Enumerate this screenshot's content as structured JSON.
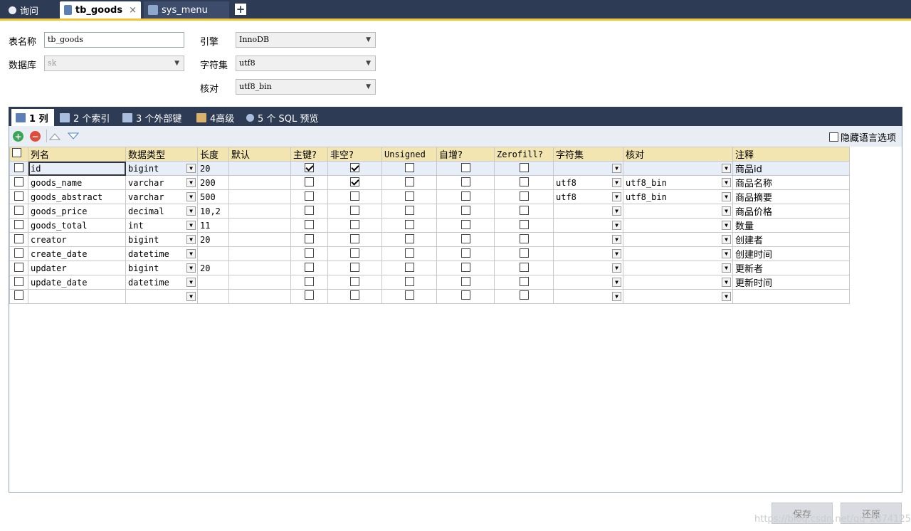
{
  "tabs": [
    {
      "label": "询问",
      "active": false
    },
    {
      "label": "tb_goods",
      "active": true,
      "close": "×"
    },
    {
      "label": "sys_menu",
      "active": false
    }
  ],
  "new_tab": "+",
  "form": {
    "table_name_label": "表名称",
    "table_name_value": "tb_goods",
    "database_label": "数据库",
    "database_value": "sk",
    "engine_label": "引擎",
    "engine_value": "InnoDB",
    "charset_label": "字符集",
    "charset_value": "utf8",
    "collation_label": "核对",
    "collation_value": "utf8_bin"
  },
  "subtabs": [
    {
      "label": "1 列",
      "active": true
    },
    {
      "label": "2 个索引",
      "active": false
    },
    {
      "label": "3 个外部键",
      "active": false
    },
    {
      "label": "4高级",
      "active": false
    },
    {
      "label": "5 个 SQL 预览",
      "active": false
    }
  ],
  "toolbar": {
    "hide_lang_label": "隐藏语言选项"
  },
  "columns": [
    "列名",
    "数据类型",
    "长度",
    "默认",
    "主键?",
    "非空?",
    "Unsigned",
    "自增?",
    "Zerofill?",
    "字符集",
    "核对",
    "注释"
  ],
  "rows": [
    {
      "name": "id",
      "type": "bigint",
      "length": "20",
      "default": "",
      "pk": true,
      "notnull": true,
      "unsigned": false,
      "autoinc": false,
      "zerofill": false,
      "charset": "",
      "collation": "",
      "comment": "商品id"
    },
    {
      "name": "goods_name",
      "type": "varchar",
      "length": "200",
      "default": "",
      "pk": false,
      "notnull": true,
      "unsigned": false,
      "autoinc": false,
      "zerofill": false,
      "charset": "utf8",
      "collation": "utf8_bin",
      "comment": "商品名称"
    },
    {
      "name": "goods_abstract",
      "type": "varchar",
      "length": "500",
      "default": "",
      "pk": false,
      "notnull": false,
      "unsigned": false,
      "autoinc": false,
      "zerofill": false,
      "charset": "utf8",
      "collation": "utf8_bin",
      "comment": "商品摘要"
    },
    {
      "name": "goods_price",
      "type": "decimal",
      "length": "10,2",
      "default": "",
      "pk": false,
      "notnull": false,
      "unsigned": false,
      "autoinc": false,
      "zerofill": false,
      "charset": "",
      "collation": "",
      "comment": "商品价格"
    },
    {
      "name": "goods_total",
      "type": "int",
      "length": "11",
      "default": "",
      "pk": false,
      "notnull": false,
      "unsigned": false,
      "autoinc": false,
      "zerofill": false,
      "charset": "",
      "collation": "",
      "comment": "数量"
    },
    {
      "name": "creator",
      "type": "bigint",
      "length": "20",
      "default": "",
      "pk": false,
      "notnull": false,
      "unsigned": false,
      "autoinc": false,
      "zerofill": false,
      "charset": "",
      "collation": "",
      "comment": "创建者"
    },
    {
      "name": "create_date",
      "type": "datetime",
      "length": "",
      "default": "",
      "pk": false,
      "notnull": false,
      "unsigned": false,
      "autoinc": false,
      "zerofill": false,
      "charset": "",
      "collation": "",
      "comment": "创建时间"
    },
    {
      "name": "updater",
      "type": "bigint",
      "length": "20",
      "default": "",
      "pk": false,
      "notnull": false,
      "unsigned": false,
      "autoinc": false,
      "zerofill": false,
      "charset": "",
      "collation": "",
      "comment": "更新者"
    },
    {
      "name": "update_date",
      "type": "datetime",
      "length": "",
      "default": "",
      "pk": false,
      "notnull": false,
      "unsigned": false,
      "autoinc": false,
      "zerofill": false,
      "charset": "",
      "collation": "",
      "comment": "更新时间"
    },
    {
      "name": "",
      "type": "",
      "length": "",
      "default": "",
      "pk": false,
      "notnull": false,
      "unsigned": false,
      "autoinc": false,
      "zerofill": false,
      "charset": "",
      "collation": "",
      "comment": ""
    }
  ],
  "buttons": {
    "save": "保存",
    "revert": "还原"
  },
  "watermark": "https://blog.csdn.net/qq_28741251",
  "colors": {
    "topbar": "#2e3b55",
    "accent": "#f4c430",
    "header": "#f3e5b0",
    "selected_row": "#e8eef8"
  }
}
